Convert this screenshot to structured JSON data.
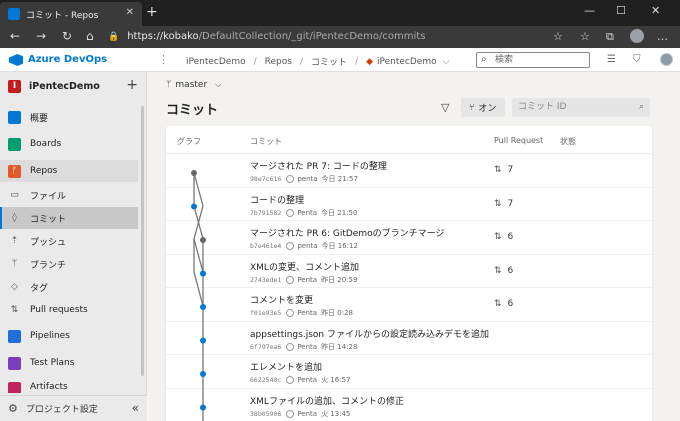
{
  "browser": {
    "tab_title": "コミット - Repos",
    "url_host": "https://kobako",
    "url_path": "/DefaultCollection/_git/iPentecDemo/commits"
  },
  "header": {
    "brand": "Azure DevOps",
    "breadcrumb": [
      "iPentecDemo",
      "Repos",
      "コミット",
      "iPentecDemo"
    ],
    "search_placeholder": "検索"
  },
  "sidebar": {
    "project_badge": "I",
    "project_name": "iPentecDemo",
    "items": [
      {
        "label": "概要"
      },
      {
        "label": "Boards"
      },
      {
        "label": "Repos"
      },
      {
        "label": "ファイル"
      },
      {
        "label": "コミット"
      },
      {
        "label": "プッシュ"
      },
      {
        "label": "ブランチ"
      },
      {
        "label": "タグ"
      },
      {
        "label": "Pull requests"
      },
      {
        "label": "Pipelines"
      },
      {
        "label": "Test Plans"
      },
      {
        "label": "Artifacts"
      }
    ],
    "footer_label": "プロジェクト設定"
  },
  "main": {
    "branch": "master",
    "title": "コミット",
    "toggle_label": "オン",
    "commit_search_placeholder": "コミット ID",
    "columns": [
      "グラフ",
      "コミット",
      "Pull Request",
      "状態"
    ],
    "commits": [
      {
        "message": "マージされた PR 7: コードの整理",
        "hash": "98e7c616",
        "author": "penta",
        "date": "今日 21:57",
        "pr": "7"
      },
      {
        "message": "コードの整理",
        "hash": "7b791582",
        "author": "Penta",
        "date": "今日 21:50",
        "pr": "7"
      },
      {
        "message": "マージされた PR 6: GitDemoのブランチマージ",
        "hash": "b7e461e4",
        "author": "penta",
        "date": "今日 16:12",
        "pr": "6"
      },
      {
        "message": "XMLの変更、コメント追加",
        "hash": "2743ede1",
        "author": "Penta",
        "date": "昨日 20:59",
        "pr": "6"
      },
      {
        "message": "コメントを変更",
        "hash": "f01e93e5",
        "author": "Penta",
        "date": "昨日 0:28",
        "pr": "6"
      },
      {
        "message": "appsettings.json ファイルからの設定読み込みデモを追加",
        "hash": "6f797ea6",
        "author": "Penta",
        "date": "昨日 14:28",
        "pr": ""
      },
      {
        "message": "エレメントを追加",
        "hash": "6622540c",
        "author": "Penta",
        "date": "火 16:57",
        "pr": ""
      },
      {
        "message": "XMLファイルの追加、コメントの修正",
        "hash": "38b05906",
        "author": "Penta",
        "date": "火 13:45",
        "pr": ""
      }
    ]
  },
  "colors": {
    "accent": "#0078d4",
    "graph_merge": "#666666",
    "graph_commit": "#0078d4"
  }
}
